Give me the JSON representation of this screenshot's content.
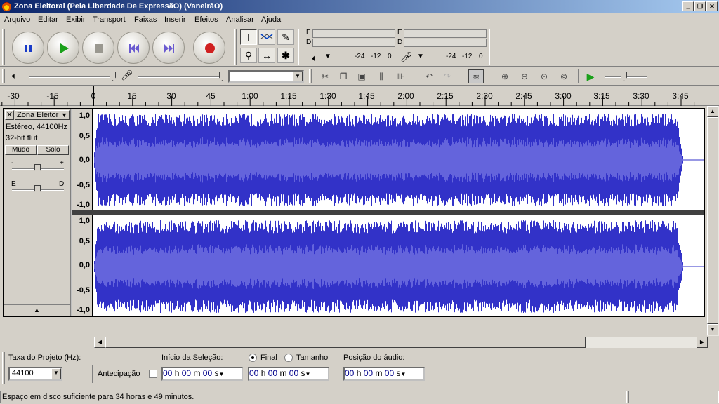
{
  "window": {
    "title": "Zona Eleitoral (Pela Liberdade De ExpressãO) (VaneirãO)",
    "buttons": [
      "_",
      "❐",
      "✕"
    ]
  },
  "menu": [
    "Arquivo",
    "Editar",
    "Exibir",
    "Transport",
    "Faixas",
    "Inserir",
    "Efeitos",
    "Analisar",
    "Ajuda"
  ],
  "transport": {
    "icons": [
      "pause-icon",
      "play-icon",
      "stop-icon",
      "skip-start-icon",
      "skip-end-icon",
      "record-icon"
    ],
    "colors": {
      "pause": "#1a3cc8",
      "play": "#1aa01a",
      "stop": "#9a9890",
      "skip": "#6a5ad0",
      "record": "#d02020"
    }
  },
  "tools": [
    "selection-tool",
    "envelope-tool",
    "draw-tool",
    "zoom-tool",
    "timeshift-tool",
    "multi-tool"
  ],
  "meters": {
    "play_channels": [
      "E",
      "D"
    ],
    "rec_channels": [
      "E",
      "D"
    ],
    "scale": [
      "-24",
      "-12",
      "0"
    ]
  },
  "device_combo": {
    "value": ""
  },
  "ruler": {
    "labels": [
      "-30",
      "-15",
      "0",
      "15",
      "30",
      "45",
      "1:00",
      "1:15",
      "1:30",
      "1:45",
      "2:00",
      "2:15",
      "2:30",
      "2:45",
      "3:00",
      "3:15",
      "3:30",
      "3:45"
    ]
  },
  "track": {
    "name": "Zona Eleitor",
    "format": "Estéreo, 44100Hz",
    "bits": "32-bit flut",
    "mute": "Mudo",
    "solo": "Solo",
    "gain_minus": "-",
    "gain_plus": "+",
    "pan_left": "E",
    "pan_right": "D",
    "scale_labels": [
      "1,0",
      "0,5",
      "0,0",
      "-0,5",
      "-1,0"
    ],
    "wave_color": "#3232c8",
    "wave_rms_color": "#6464dc"
  },
  "selection": {
    "rate_label": "Taxa do Projeto (Hz):",
    "rate_value": "44100",
    "snap_label": "Antecipação",
    "start_label": "Início da Seleção:",
    "end_label": "Final",
    "length_label": "Tamanho",
    "pos_label": "Posição do áudio:",
    "time": {
      "hh": "00",
      "h": "h",
      "mm": "00",
      "m": "m",
      "ss": "00",
      "s": "s"
    }
  },
  "status": {
    "text": "Espaço em disco suficiente para 34 horas e 49 minutos."
  }
}
